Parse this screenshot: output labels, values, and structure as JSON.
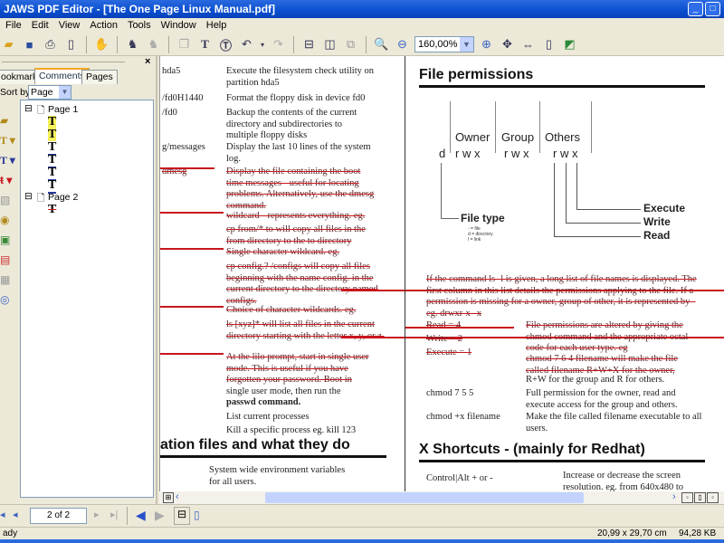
{
  "window": {
    "title": "JAWS PDF Editor - [The One Page Linux Manual.pdf]"
  },
  "menu": [
    "File",
    "Edit",
    "View",
    "Action",
    "Tools",
    "Window",
    "Help"
  ],
  "toolbar": {
    "zoom": "160,00%"
  },
  "panel": {
    "tabs": [
      "ookmarks",
      "Comments",
      "Pages"
    ],
    "sort_label": "Sort by:",
    "sort_value": "Page",
    "pages": [
      "Page 1",
      "Page 2"
    ]
  },
  "doc": {
    "left_rows": [
      {
        "cmd": "hda5",
        "desc": "Execute the filesystem check utility on partition hda5"
      },
      {
        "cmd": "/fd0H1440",
        "desc": "Format the floppy disk in device fd0"
      },
      {
        "cmd": "/fd0",
        "desc": "Backup the contents of the current directory and subdirectories to multiple floppy disks"
      },
      {
        "cmd": "g/messages",
        "desc": "Display the last 10 lines of the system log."
      },
      {
        "cmd": "dmesg",
        "desc": "Display the file containing the boot time messages - useful for locating problems. Alternatively, use the dmesg command."
      },
      {
        "cmd": "",
        "desc": "wildcard - represents everything. eg."
      },
      {
        "cmd": "",
        "desc": "cp from/* to  will copy all files in the from directory to the to directory"
      },
      {
        "cmd": "",
        "desc": "Single character wildcard. eg."
      },
      {
        "cmd": "",
        "desc": "cp config.? /configs will copy all files beginning with the name config. in the current directory to the directory named configs."
      },
      {
        "cmd": "",
        "desc": "Choice of character wildcards. eg."
      },
      {
        "cmd": "",
        "desc": "ls [xyz]* will list all files in the current directory starting with the letter x, y, or z."
      },
      {
        "cmd": "",
        "desc": "At the lilo prompt, start in single user mode. This is useful if you have forgotten your password. Boot in"
      },
      {
        "cmd": "",
        "desc": "single user mode, then run the"
      },
      {
        "cmd": "",
        "desc": "passwd command."
      },
      {
        "cmd": "",
        "desc": "List current processes"
      },
      {
        "cmd": "",
        "desc": "Kill a specific process eg. kill 123"
      }
    ],
    "left_heading": "ation files and what they do",
    "left_after": "System wide environment variables for all users.",
    "right_heading": "File permissions",
    "diagram": {
      "headers": [
        "Owner",
        "Group",
        "Others"
      ],
      "d": "d",
      "rwx": "r w x",
      "labels": [
        "Execute",
        "Write",
        "Read"
      ],
      "filetype": "File type",
      "legend": [
        "- = file",
        "d = directory",
        "l = link"
      ]
    },
    "para": "If the command ls -l is given, a long list of file names is displayed. The first column in this list details the permissions applying to the file. If a permission is missing for a owner, group of other, it is represented by - eg.  drwxr-x--x",
    "perm_vals": [
      "Read = 4",
      "Write = 2",
      "Execute = 1"
    ],
    "perm_desc1": "File permissions are altered by giving the chmod command and the appropriate octal code for each user type. eg",
    "perm_desc2a": "chmod 7 6 4 filename will make the file called filename R+W+X for the owner,",
    "perm_desc2b": "R+W for the group and R for others.",
    "chmod_rows": [
      {
        "cmd": "chmod 7 5 5",
        "desc": "Full permission for the owner, read and execute access for the group and others."
      },
      {
        "cmd": "chmod +x filename",
        "desc": "Make the file called filename executable to all users."
      }
    ],
    "x_heading": "X Shortcuts - (mainly for Redhat)",
    "x_row": {
      "cmd": "Control|Alt  + or -",
      "desc": "Increase or decrease the screen resolution. eg. from 640x480 to"
    }
  },
  "nav": {
    "page": "2 of 2"
  },
  "status": {
    "left": "ady",
    "size": "20,99 x 29,70 cm",
    "filesize": "94,28 KB"
  }
}
